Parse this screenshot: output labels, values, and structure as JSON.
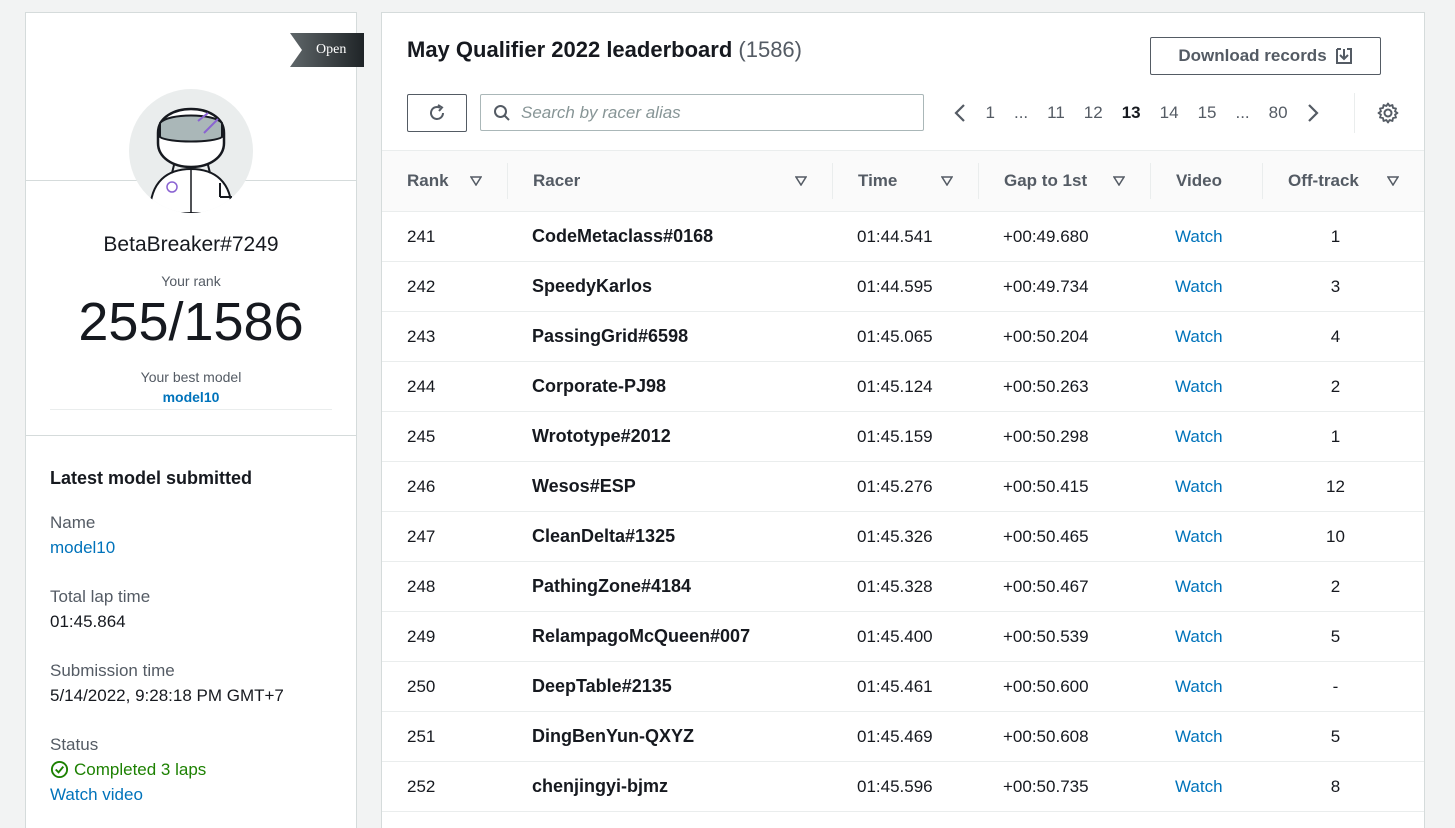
{
  "profile": {
    "badge": "Open",
    "name": "BetaBreaker#7249",
    "rank_label": "Your rank",
    "rank_value": "255/1586",
    "best_model_label": "Your best model",
    "best_model_value": "model10"
  },
  "latest": {
    "title": "Latest model submitted",
    "name_label": "Name",
    "name_value": "model10",
    "lap_label": "Total lap time",
    "lap_value": "01:45.864",
    "submission_label": "Submission time",
    "submission_value": "5/14/2022, 9:28:18 PM GMT+7",
    "status_label": "Status",
    "status_value": "Completed 3 laps",
    "watch_link": "Watch video"
  },
  "board": {
    "title": "May Qualifier 2022 leaderboard",
    "count": "(1586)",
    "download_label": "Download records",
    "search_placeholder": "Search by racer alias",
    "pages": [
      "1",
      "...",
      "11",
      "12",
      "13",
      "14",
      "15",
      "...",
      "80"
    ],
    "current_page": "13",
    "columns": [
      "Rank",
      "Racer",
      "Time",
      "Gap to 1st",
      "Video",
      "Off-track"
    ],
    "rows": [
      {
        "rank": "241",
        "racer": "CodeMetaclass#0168",
        "time": "01:44.541",
        "gap": "+00:49.680",
        "video": "Watch",
        "offtrack": "1"
      },
      {
        "rank": "242",
        "racer": "SpeedyKarlos",
        "time": "01:44.595",
        "gap": "+00:49.734",
        "video": "Watch",
        "offtrack": "3"
      },
      {
        "rank": "243",
        "racer": "PassingGrid#6598",
        "time": "01:45.065",
        "gap": "+00:50.204",
        "video": "Watch",
        "offtrack": "4"
      },
      {
        "rank": "244",
        "racer": "Corporate-PJ98",
        "time": "01:45.124",
        "gap": "+00:50.263",
        "video": "Watch",
        "offtrack": "2"
      },
      {
        "rank": "245",
        "racer": "Wrototype#2012",
        "time": "01:45.159",
        "gap": "+00:50.298",
        "video": "Watch",
        "offtrack": "1"
      },
      {
        "rank": "246",
        "racer": "Wesos#ESP",
        "time": "01:45.276",
        "gap": "+00:50.415",
        "video": "Watch",
        "offtrack": "12"
      },
      {
        "rank": "247",
        "racer": "CleanDelta#1325",
        "time": "01:45.326",
        "gap": "+00:50.465",
        "video": "Watch",
        "offtrack": "10"
      },
      {
        "rank": "248",
        "racer": "PathingZone#4184",
        "time": "01:45.328",
        "gap": "+00:50.467",
        "video": "Watch",
        "offtrack": "2"
      },
      {
        "rank": "249",
        "racer": "RelampagoMcQueen#007",
        "time": "01:45.400",
        "gap": "+00:50.539",
        "video": "Watch",
        "offtrack": "5"
      },
      {
        "rank": "250",
        "racer": "DeepTable#2135",
        "time": "01:45.461",
        "gap": "+00:50.600",
        "video": "Watch",
        "offtrack": "-"
      },
      {
        "rank": "251",
        "racer": "DingBenYun-QXYZ",
        "time": "01:45.469",
        "gap": "+00:50.608",
        "video": "Watch",
        "offtrack": "5"
      },
      {
        "rank": "252",
        "racer": "chenjingyi-bjmz",
        "time": "01:45.596",
        "gap": "+00:50.735",
        "video": "Watch",
        "offtrack": "8"
      }
    ]
  },
  "colors": {
    "link": "#0073bb",
    "success": "#1d8102",
    "text": "#16191f",
    "muted": "#545b64",
    "accent_purple": "#8a63d2"
  },
  "icons": {
    "refresh": "refresh-icon",
    "search": "search-icon",
    "download": "download-icon",
    "settings": "gear-icon",
    "prev": "chevron-left-icon",
    "next": "chevron-right-icon",
    "status": "check-circle-icon",
    "sort": "caret-down-icon"
  }
}
